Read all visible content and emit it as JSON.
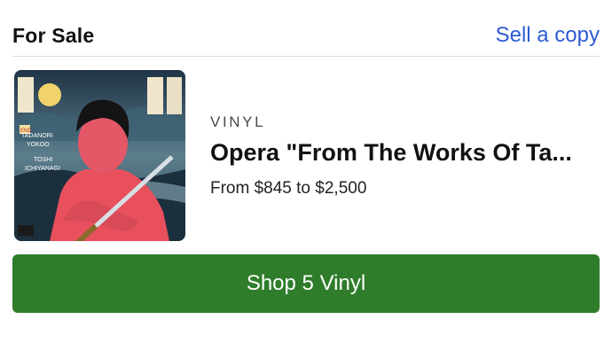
{
  "header": {
    "title": "For Sale",
    "sell_link": "Sell a copy"
  },
  "item": {
    "format": "VINYL",
    "title": "Opera \"From The Works Of Ta...",
    "price_range": "From $845 to $2,500",
    "cover_alt": "Album cover",
    "cover_text": {
      "artist_line1": "TADANORI",
      "artist_line2": "YOKOO",
      "artist_line3": "TOSHI",
      "artist_line4": "ICHIYANAGI",
      "badge": "END"
    }
  },
  "shop_button": {
    "label": "Shop 5 Vinyl"
  },
  "colors": {
    "link": "#2d5bd3",
    "button": "#2f7d2b",
    "divider": "#d9d9d9"
  }
}
